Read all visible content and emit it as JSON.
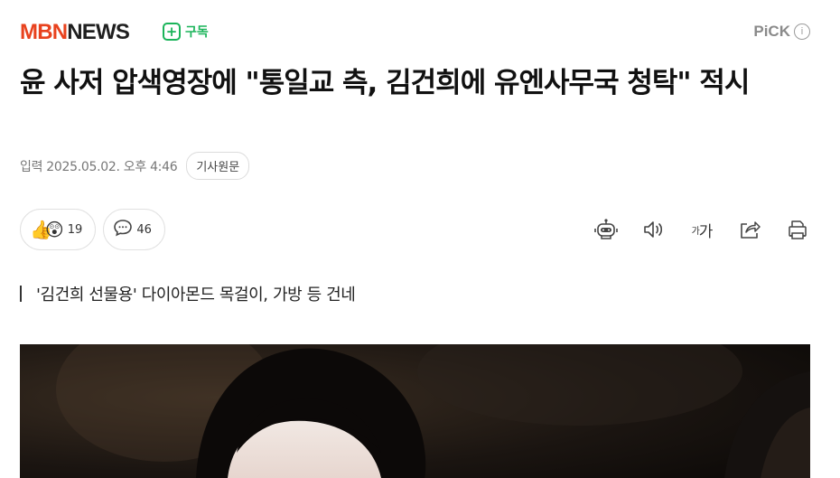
{
  "header": {
    "logo_mbn": "MBN",
    "logo_news": "NEWS",
    "subscribe_label": "구독",
    "pick_label": "PiCK",
    "pick_info": "i"
  },
  "article": {
    "title": "윤 사저 압색영장에 \"통일교 측, 김건희에 유엔사무국 청탁\" 적시",
    "date": "입력 2025.05.02. 오후 4:46",
    "original_button": "기사원문",
    "summary": "'김건희 선물용' 다이아몬드 목걸이, 가방 등 건네"
  },
  "reactions": {
    "emoji": "👍😲",
    "reaction_count": "19",
    "comment_count": "46"
  },
  "tools": {
    "font_small": "가",
    "font_large": "가"
  },
  "colors": {
    "brand_red": "#e8421e",
    "subscribe_green": "#1bb45a"
  }
}
